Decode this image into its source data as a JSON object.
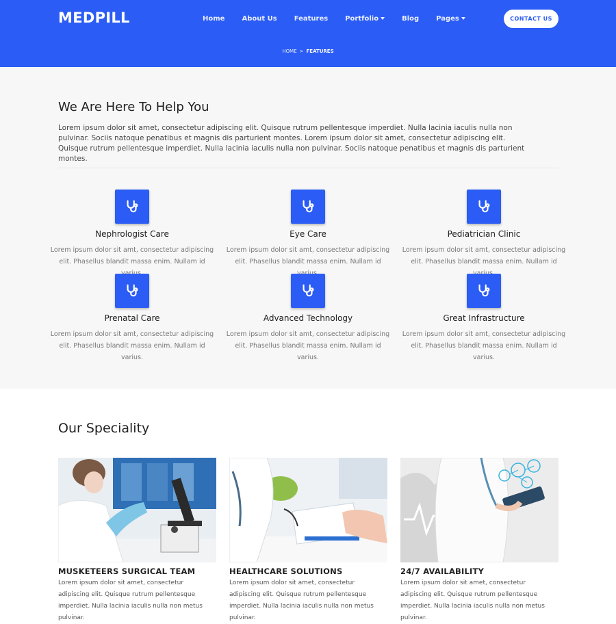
{
  "header": {
    "logo": "MEDPILL",
    "nav": [
      {
        "label": "Home"
      },
      {
        "label": "About Us"
      },
      {
        "label": "Features"
      },
      {
        "label": "Portfolio"
      },
      {
        "label": "Blog"
      },
      {
        "label": "Pages"
      }
    ],
    "contact_label": "CONTACT US",
    "breadcrumb": {
      "home": "HOME",
      "separator": ">",
      "current": "FEATURES"
    },
    "accent_color": "#2b5cf5"
  },
  "help": {
    "title": "We Are Here To Help You",
    "text": "Lorem ipsum dolor sit amet, consectetur adipiscing elit. Quisque rutrum pellentesque imperdiet. Nulla lacinia iaculis nulla non pulvinar. Sociis natoque penatibus et magnis dis parturient montes. Lorem ipsum dolor sit amet, consectetur adipiscing elit. Quisque rutrum pellentesque imperdiet. Nulla lacinia iaculis nulla non pulvinar. Sociis natoque penatibus et magnis dis parturient montes.",
    "features": [
      {
        "icon": "stethoscope-icon",
        "title": "Nephrologist Care",
        "text": "Lorem ipsum dolor sit amt, consectetur adipiscing elit. Phasellus blandit massa enim. Nullam id varius."
      },
      {
        "icon": "stethoscope-icon",
        "title": "Eye Care",
        "text": "Lorem ipsum dolor sit amt, consectetur adipiscing elit. Phasellus blandit massa enim. Nullam id varius."
      },
      {
        "icon": "stethoscope-icon",
        "title": "Pediatrician Clinic",
        "text": "Lorem ipsum dolor sit amt, consectetur adipiscing elit. Phasellus blandit massa enim. Nullam id varius."
      },
      {
        "icon": "stethoscope-icon",
        "title": "Prenatal Care",
        "text": "Lorem ipsum dolor sit amt, consectetur adipiscing elit. Phasellus blandit massa enim. Nullam id varius."
      },
      {
        "icon": "stethoscope-icon",
        "title": "Advanced Technology",
        "text": "Lorem ipsum dolor sit amt, consectetur adipiscing elit. Phasellus blandit massa enim. Nullam id varius."
      },
      {
        "icon": "stethoscope-icon",
        "title": "Great Infrastructure",
        "text": "Lorem ipsum dolor sit amt, consectetur adipiscing elit. Phasellus blandit massa enim. Nullam id varius."
      }
    ]
  },
  "speciality": {
    "title": "Our Speciality",
    "cards": [
      {
        "image": "lab-microscope-photo",
        "title": "MUSKETEERS SURGICAL TEAM",
        "text": "Lorem ipsum dolor sit amet, consectetur adipiscing elit. Quisque rutrum pellentesque imperdiet. Nulla lacinia iaculis nulla non metus pulvinar."
      },
      {
        "image": "doctor-writing-photo",
        "title": "HEALTHCARE SOLUTIONS",
        "text": "Lorem ipsum dolor sit amet, consectetur adipiscing elit. Quisque rutrum pellentesque imperdiet. Nulla lacinia iaculis nulla non metus pulvinar."
      },
      {
        "image": "doctor-tablet-photo",
        "title": "24/7 AVAILABILITY",
        "text": "Lorem ipsum dolor sit amet, consectetur adipiscing elit. Quisque rutrum pellentesque imperdiet. Nulla lacinia iaculis nulla non metus pulvinar."
      }
    ]
  }
}
